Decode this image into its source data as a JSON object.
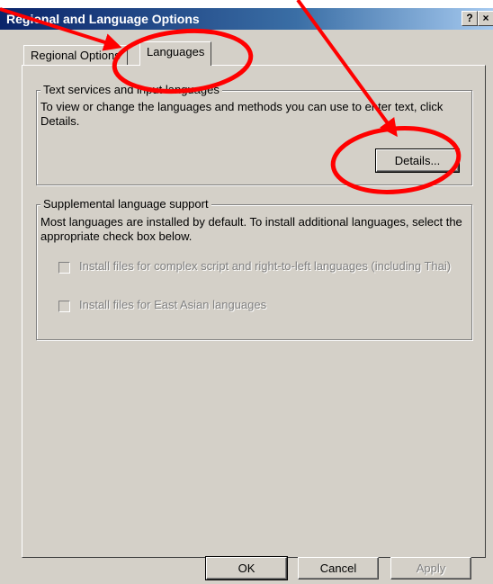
{
  "window": {
    "title": "Regional and Language Options",
    "help_label": "?",
    "close_label": "×"
  },
  "tabs": [
    {
      "label": "Regional Options",
      "active": false
    },
    {
      "label": "Languages",
      "active": true
    }
  ],
  "text_services": {
    "legend": "Text services and input languages",
    "description": "To view or change the languages and methods you can use to enter text, click Details.",
    "details_button": "Details..."
  },
  "supplemental": {
    "legend": "Supplemental language support",
    "description": "Most languages are installed by default. To install additional languages, select the appropriate check box below.",
    "checkbox_complex": {
      "label": "Install files for complex script and right-to-left languages (including Thai)",
      "checked": false,
      "enabled": false
    },
    "checkbox_east_asian": {
      "label": "Install files for East Asian languages",
      "checked": false,
      "enabled": false
    }
  },
  "buttons": {
    "ok": "OK",
    "cancel": "Cancel",
    "apply": "Apply"
  },
  "colors": {
    "annotation": "#ff0000",
    "titlebar": "#0a246a",
    "dialog_face": "#d4d0c8"
  }
}
